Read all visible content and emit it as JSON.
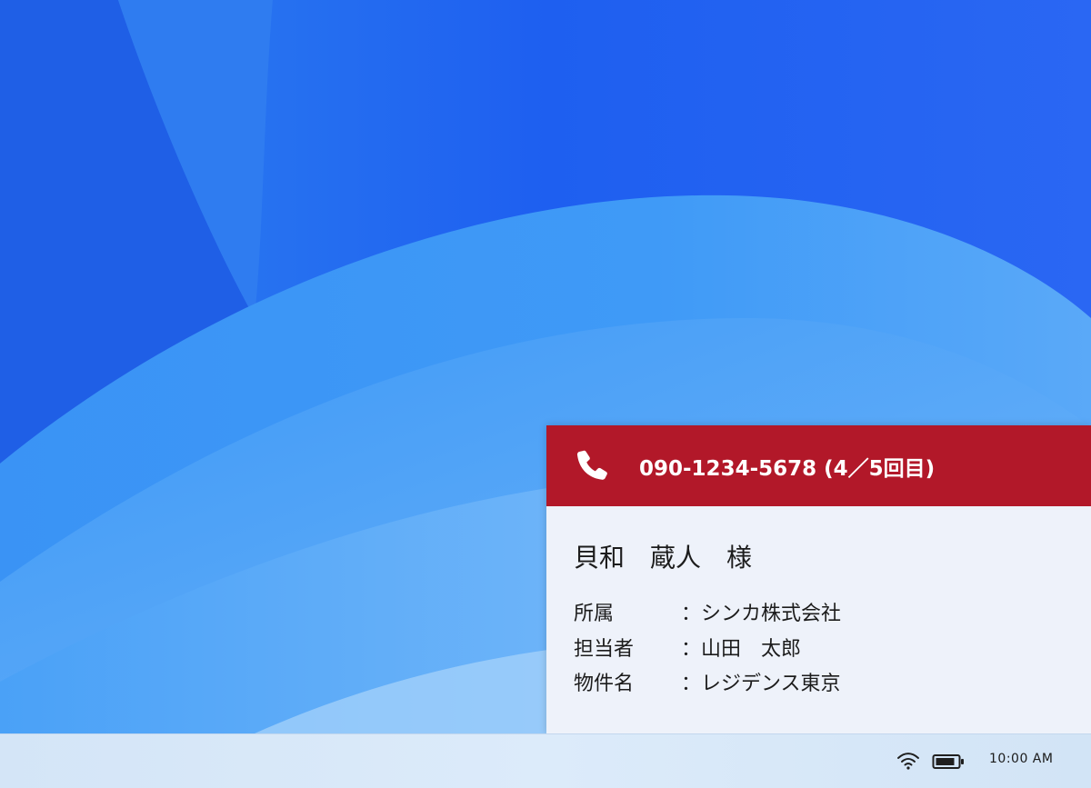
{
  "call": {
    "phone_number": "090-1234-5678 (4／5回目)",
    "caller_name": "貝和　蔵人　様",
    "details": [
      {
        "label": "所属",
        "sep": "：",
        "value": "シンカ株式会社"
      },
      {
        "label": "担当者",
        "sep": "：",
        "value": "山田　太郎"
      },
      {
        "label": "物件名",
        "sep": "：",
        "value": "レジデンス東京"
      }
    ],
    "header_color": "#b21829"
  },
  "taskbar": {
    "time": "10:00 AM",
    "icons": [
      "wifi-icon",
      "battery-icon"
    ]
  }
}
